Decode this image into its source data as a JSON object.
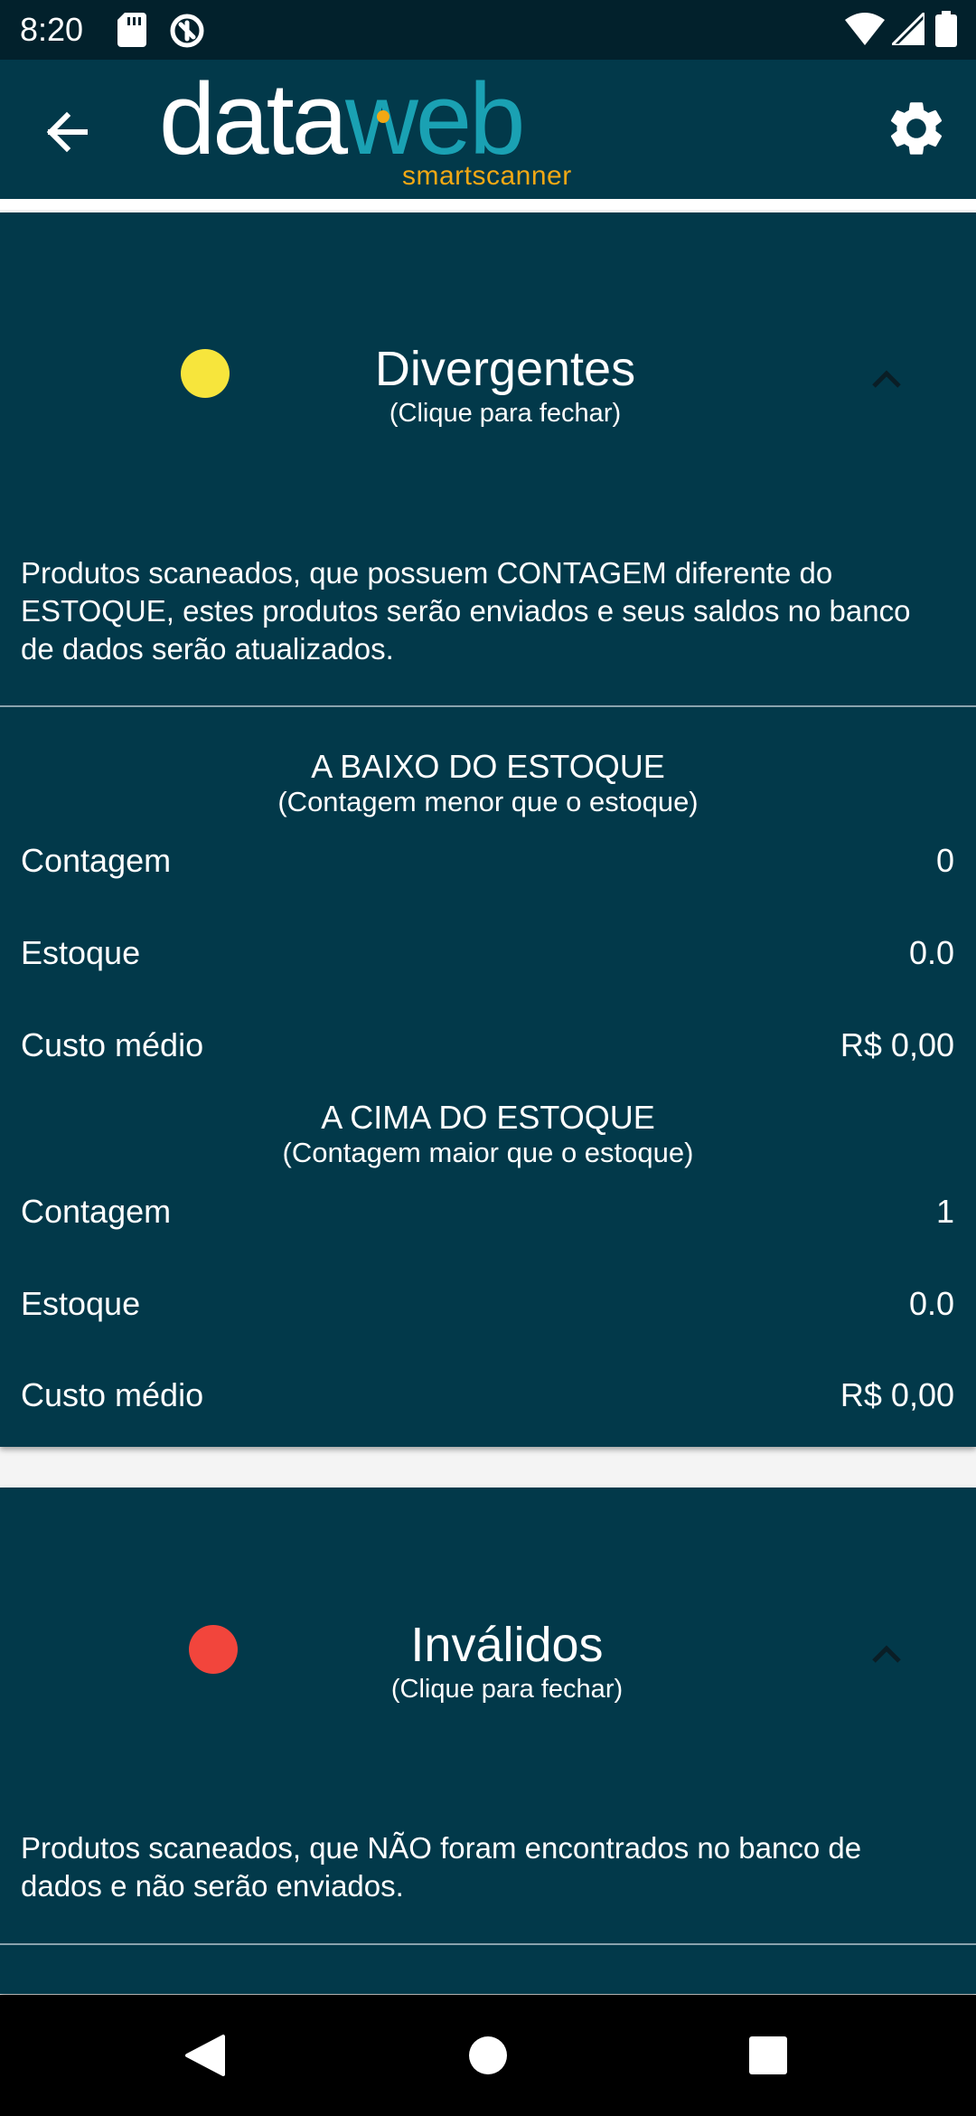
{
  "status_bar": {
    "time": "8:20"
  },
  "app_bar": {
    "logo_part1": "data",
    "logo_part2": "web",
    "logo_tagline": "smartscanner"
  },
  "sections": [
    {
      "title": "Divergentes",
      "subtitle": "(Clique para fechar)",
      "indicator_color": "#f7e53c",
      "description": "Produtos scaneados, que possuem CONTAGEM diferente do ESTOQUE, estes produtos serão enviados e seus saldos no banco de dados serão atualizados.",
      "groups": [
        {
          "title": "A BAIXO DO ESTOQUE",
          "subtitle": "(Contagem menor que o estoque)",
          "rows": [
            {
              "label": "Contagem",
              "value": "0"
            },
            {
              "label": "Estoque",
              "value": "0.0"
            },
            {
              "label": "Custo médio",
              "value": "R$ 0,00"
            }
          ]
        },
        {
          "title": "A CIMA DO ESTOQUE",
          "subtitle": "(Contagem maior que o estoque)",
          "rows": [
            {
              "label": "Contagem",
              "value": "1"
            },
            {
              "label": "Estoque",
              "value": "0.0"
            },
            {
              "label": "Custo médio",
              "value": "R$ 0,00"
            }
          ]
        }
      ]
    },
    {
      "title": "Inválidos",
      "subtitle": "(Clique para fechar)",
      "indicator_color": "#f2453c",
      "description": "Produtos scaneados, que NÃO foram encontrados no banco de dados e não serão enviados."
    }
  ],
  "colors": {
    "app_bar": "#02394a",
    "card": "#02394a",
    "brand_teal": "#1aa1b3",
    "brand_orange": "#f2a814"
  },
  "icons": {
    "back": "arrow-left-icon",
    "settings": "gear-icon",
    "expand": "chevron-up-icon",
    "nav_back": "triangle-back-icon",
    "nav_home": "circle-home-icon",
    "nav_recents": "square-recents-icon"
  }
}
